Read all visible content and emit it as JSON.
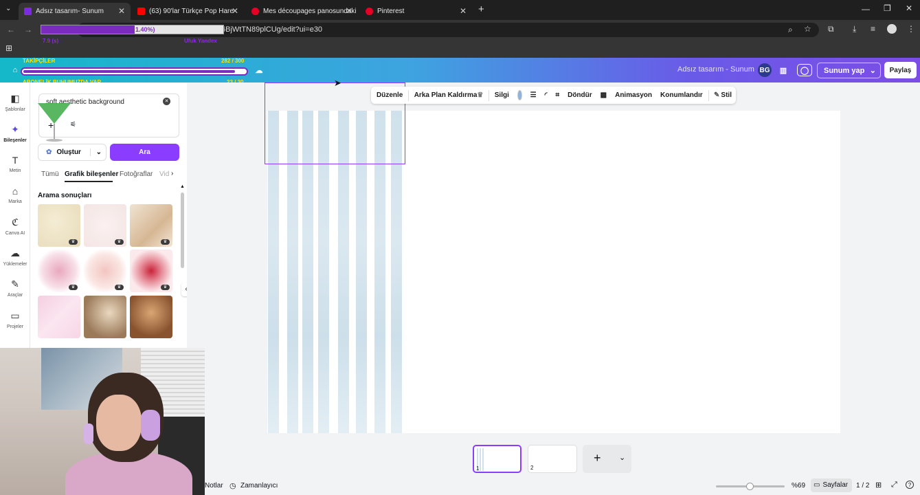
{
  "browser": {
    "tabs": [
      {
        "title": "Adsız tasarım- Sunum",
        "color": "#7d2ae8"
      },
      {
        "title": "(63) 90'lar Türkçe Pop Hare",
        "color": "#ff0000"
      },
      {
        "title": "Mes découpages panosundaki",
        "color": "#e60023"
      },
      {
        "title": "Pinterest",
        "color": "#e60023"
      }
    ],
    "url": "6BjWtTN89plCUg/edit?ui=e30",
    "new_tab": "+"
  },
  "overlay": {
    "progress_label": "1.40%)",
    "left_small": "TAKİPÇİLER",
    "left_small_value": "282 / 300",
    "abonelik": "ABONELİK BUHUMUZDA VAR",
    "abonelik_value": "23 / 30",
    "purple_left": "7.9 (s)",
    "purple_right": "Ufuk Yandex"
  },
  "canva_header": {
    "doc_title": "Adsız tasarım - Sunum",
    "avatar": "BG",
    "present_label": "Sunum yap",
    "share_label": "Paylaş"
  },
  "rail": [
    {
      "label": "Şablonlar",
      "icon": "templates-icon",
      "glyph": "◧"
    },
    {
      "label": "Bileşenler",
      "icon": "elements-icon",
      "glyph": "✦"
    },
    {
      "label": "Metin",
      "icon": "text-icon",
      "glyph": "T"
    },
    {
      "label": "Marka",
      "icon": "brand-icon",
      "glyph": "⌂"
    },
    {
      "label": "Canva AI",
      "icon": "canva-ai-icon",
      "glyph": "ℭ"
    },
    {
      "label": "Yüklemeler",
      "icon": "upload-icon",
      "glyph": "☁"
    },
    {
      "label": "Araçlar",
      "icon": "tools-icon",
      "glyph": "✎"
    },
    {
      "label": "Projeler",
      "icon": "folder-icon",
      "glyph": "▭"
    }
  ],
  "panel": {
    "search_value": "soft aesthetic background",
    "create_label": "Oluştur",
    "search_button": "Ara",
    "tabs": [
      "Tümü",
      "Grafik bileşenler",
      "Fotoğraflar",
      "Vid"
    ],
    "results_heading": "Arama sonuçları"
  },
  "toolbar": {
    "edit": "Düzenle",
    "bg_remove": "Arka Plan Kaldırma",
    "eraser": "Silgi",
    "color": "#8fb3d9",
    "rotate": "Döndür",
    "animate": "Animasyon",
    "position": "Konumlandır",
    "style": "Stil"
  },
  "footer": {
    "notes": "Notlar",
    "timer": "Zamanlayıcı",
    "zoom": "%69",
    "pages_label": "Sayfalar",
    "page_count": "1 / 2",
    "page1": "1",
    "page2": "2",
    "add": "+"
  }
}
